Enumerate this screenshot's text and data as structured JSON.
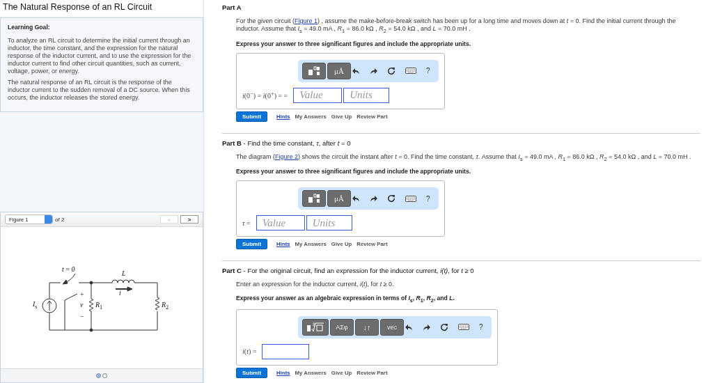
{
  "title": "The Natural Response of an RL Circuit",
  "learning_goal": {
    "heading": "Learning Goal:",
    "paragraphs": [
      "To analyze an RL circuit to determine the initial current through an inductor, the time constant, and the expression for the natural response of the inductor current, and to use the expression for the inductor current to find other circuit quantities, such as current, voltage, power, or energy.",
      "The natural response of an RL circuit is the response of the inductor current to the sudden removal of a DC source. When this occurs, the inductor releases the stored energy."
    ]
  },
  "figure_viewer": {
    "select": "Figure 1",
    "of_label": "of 2",
    "prev_button": {
      "label": "<",
      "disabled": true
    },
    "next_button": {
      "label": ">",
      "disabled": false
    },
    "circuit_labels": [
      "*t* = *0*",
      "*L*",
      "+",
      "*i*",
      "*I*$_{s}$",
      "*v*",
      "*R*$_{1}$",
      "*R*$_{2}$",
      "−"
    ],
    "pages": [
      {
        "selected": true
      },
      {
        "selected": false
      }
    ]
  },
  "parts": [
    {
      "label": "Part A",
      "prompt": "For the given circuit (",
      "figure_link": "Figure 1",
      "prompt_end": ") , assume the make-before-break switch has been up for a long time and moves down at *t* = 0. Find the initial current through the inductor. Assume that *I*$_{s}$ = 49.0 mA , *R*$_{1}$ = 86.0 kΩ , *R*$_{2}$ = 54.0 kΩ , and *L* = 70.0 mH .",
      "instruction": "Express your answer to three significant figures and include the appropriate units.",
      "toolbar": [
        {
          "kind": "template"
        },
        {
          "kind": "text",
          "label": "μÅ"
        },
        {
          "kind": "undo"
        },
        {
          "kind": "redo"
        },
        {
          "kind": "reset"
        },
        {
          "kind": "keyboard"
        },
        {
          "kind": "help",
          "label": "?"
        }
      ],
      "answer_label": "*i*(0$^{−}$) = *i*(0$^{+}$) = =",
      "fields": [
        {
          "kind": "value",
          "placeholder": "Value"
        },
        {
          "kind": "units",
          "placeholder": "Units"
        }
      ],
      "actions": [
        {
          "kind": "submit",
          "label": "Submit"
        },
        {
          "kind": "link",
          "label": "Hints"
        },
        {
          "kind": "plain",
          "label": "My Answers"
        },
        {
          "kind": "plain",
          "label": "Give Up"
        },
        {
          "kind": "plain",
          "label": "Review Part"
        }
      ]
    },
    {
      "label": "Part B",
      "subtitle": " - Find the time constant, *τ*, after *t* = 0",
      "prompt": "The diagram (",
      "figure_link": "Figure 2",
      "prompt_end": ") shows the circuit the instant after *t* = 0. Find the time constant, *τ*. Assume that *I*$_{s}$ = 49.0 mA , *R*$_{1}$ = 86.0 kΩ , *R*$_{2}$ = 54.0 kΩ , and *L* = 70.0 mH .",
      "instruction": "Express your answer to three significant figures and include the appropriate units.",
      "toolbar": [
        {
          "kind": "template"
        },
        {
          "kind": "text",
          "label": "μÅ"
        },
        {
          "kind": "undo"
        },
        {
          "kind": "redo"
        },
        {
          "kind": "reset"
        },
        {
          "kind": "keyboard"
        },
        {
          "kind": "help",
          "label": "?"
        }
      ],
      "answer_label": "*τ* =",
      "fields": [
        {
          "kind": "value",
          "placeholder": "Value"
        },
        {
          "kind": "units",
          "placeholder": "Units"
        }
      ],
      "actions": [
        {
          "kind": "submit",
          "label": "Submit"
        },
        {
          "kind": "link",
          "label": "Hints"
        },
        {
          "kind": "plain",
          "label": "My Answers"
        },
        {
          "kind": "plain",
          "label": "Give Up"
        },
        {
          "kind": "plain",
          "label": "Review Part"
        }
      ]
    },
    {
      "label": "Part C",
      "subtitle": " - For the original circuit, find an expression for the inductor current, *i(t)*, for *t* ≥ 0",
      "prompt": "Enter an expression for the inductor current, *i*(*t*), for *t* ≥ 0.",
      "instruction": "Express your answer as an algebraic expression in terms of *I*$_{s}$, *R*$_{1}$, *R*$_{2}$, and *L*.",
      "toolbar": [
        {
          "kind": "root-template"
        },
        {
          "kind": "text",
          "label": "ΑΣφ"
        },
        {
          "kind": "text",
          "label": "↓↑"
        },
        {
          "kind": "text",
          "label": "vec"
        },
        {
          "kind": "undo"
        },
        {
          "kind": "redo"
        },
        {
          "kind": "reset"
        },
        {
          "kind": "keyboard"
        },
        {
          "kind": "help",
          "label": "?"
        }
      ],
      "answer_label": "*i*(*t*) =",
      "fields": [
        {
          "kind": "expression"
        }
      ],
      "actions": [
        {
          "kind": "submit",
          "label": "Submit"
        },
        {
          "kind": "link",
          "label": "Hints"
        },
        {
          "kind": "plain",
          "label": "My Answers"
        },
        {
          "kind": "plain",
          "label": "Give Up"
        },
        {
          "kind": "plain",
          "label": "Review Part"
        }
      ]
    }
  ]
}
